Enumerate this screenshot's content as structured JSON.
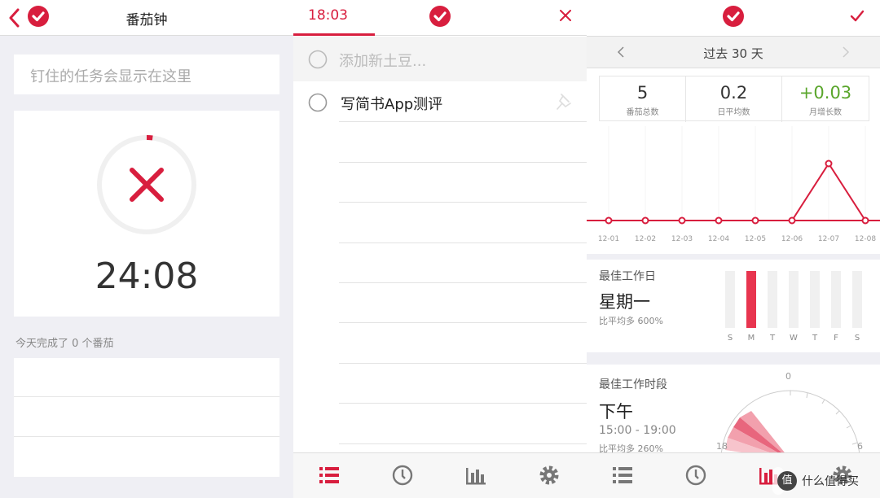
{
  "timer_screen": {
    "title": "番茄钟",
    "pinned_placeholder": "钉住的任务会显示在这里",
    "countdown": "24:08",
    "progress_fraction": 0.02,
    "done_today": "今天完成了 0 个番茄"
  },
  "tasks_screen": {
    "time": "18:03",
    "add_placeholder": "添加新土豆...",
    "tasks": [
      {
        "label": "写简书App测评"
      }
    ]
  },
  "stats_screen": {
    "period": "过去 30 天",
    "stats": [
      {
        "value": "5",
        "label": "番茄总数"
      },
      {
        "value": "0.2",
        "label": "日平均数"
      },
      {
        "value": "+0.03",
        "label": "月增长数"
      }
    ],
    "best_day": {
      "heading": "最佳工作日",
      "value": "星期一",
      "note": "比平均多 600%"
    },
    "best_period": {
      "heading": "最佳工作时段",
      "value": "下午",
      "range": "15:00 - 19:00",
      "note": "比平均多 260%"
    },
    "clock_labels": {
      "top": "0",
      "left": "18",
      "right": "6"
    }
  },
  "chart_data": [
    {
      "type": "line",
      "x": [
        "12-01",
        "12-02",
        "12-03",
        "12-04",
        "12-05",
        "12-06",
        "12-07",
        "12-08"
      ],
      "series": [
        {
          "values": [
            0,
            0,
            0,
            0,
            0,
            0,
            1,
            0
          ]
        }
      ],
      "ylim": [
        0,
        2
      ],
      "color": "#d81e3e"
    },
    {
      "type": "bar",
      "categories": [
        "S",
        "M",
        "T",
        "W",
        "T",
        "F",
        "S"
      ],
      "values": [
        0,
        1,
        0,
        0,
        0,
        0,
        0
      ],
      "color": "#e8354f"
    }
  ],
  "watermark": "值 什么值得买",
  "colors": {
    "brand": "#d81e3e",
    "positive": "#5aa62c"
  }
}
